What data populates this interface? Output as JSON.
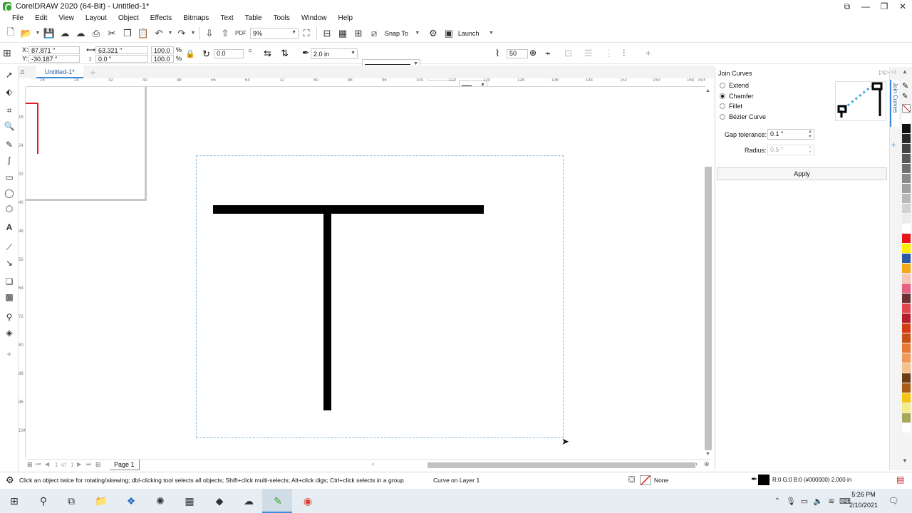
{
  "window": {
    "title": "CorelDRAW 2020 (64-Bit) - Untitled-1*"
  },
  "menu": [
    "File",
    "Edit",
    "View",
    "Layout",
    "Object",
    "Effects",
    "Bitmaps",
    "Text",
    "Table",
    "Tools",
    "Window",
    "Help"
  ],
  "toolbar": {
    "zoom": "9%",
    "snap_to": "Snap To",
    "launch": "Launch"
  },
  "propbar": {
    "x": "87.871 \"",
    "y": "-30.187 \"",
    "w": "63.321 \"",
    "h": "0.0 \"",
    "scale_x": "100.0",
    "scale_y": "100.0",
    "pct1": "%",
    "pct2": "%",
    "rotation": "0.0",
    "outline_width": "2.0 in",
    "steps": "50"
  },
  "doc": {
    "tab": "Untitled-1*"
  },
  "ruler": {
    "h_ticks": [
      "16",
      "24",
      "32",
      "40",
      "48",
      "56",
      "64",
      "72",
      "80",
      "88",
      "96",
      "104",
      "112",
      "120",
      "128",
      "136",
      "144",
      "152",
      "160",
      "168",
      "inches"
    ],
    "v_ticks": [
      "16",
      "24",
      "32",
      "40",
      "48",
      "56",
      "64",
      "72",
      "80",
      "88",
      "96",
      "104"
    ]
  },
  "pages": {
    "current": "1",
    "of_label": "of",
    "total": "1",
    "page_tab": "Page 1"
  },
  "docker": {
    "title": "Join Curves",
    "side_tab": "Join Curves",
    "options": [
      {
        "label": "Extend",
        "selected": false
      },
      {
        "label": "Chamfer",
        "selected": true
      },
      {
        "label": "Fillet",
        "selected": false
      },
      {
        "label": "Bézier Curve",
        "selected": false
      }
    ],
    "gap_label": "Gap tolerance:",
    "gap_value": "0.1 \"",
    "radius_label": "Radius:",
    "radius_value": "0.5 \"",
    "apply": "Apply"
  },
  "status": {
    "hint": "Click an object twice for rotating/skewing; dbl-clicking tool selects all objects; Shift+click multi-selects; Alt+click digs; Ctrl+click selects in a group",
    "object": "Curve on Layer 1",
    "fill": "None",
    "outline": "R:0 G:0 B:0 (#000000)  2.000 in"
  },
  "taskbar": {
    "time": "5:26 PM",
    "date": "2/10/2021"
  },
  "palette": [
    "#ffffff",
    "#111111",
    "#2a2a2a",
    "#444444",
    "#5a5a5a",
    "#707070",
    "#8a8a8a",
    "#a0a0a0",
    "#b8b8b8",
    "#d2d2d2",
    "#ebebeb",
    "#ffffff",
    "#e8141c",
    "#ffec00",
    "#2d5aa8",
    "#f6a81b",
    "#f4c6b8",
    "#e86080",
    "#6c3232",
    "#e04850",
    "#b41e2a",
    "#d43c14",
    "#c85014",
    "#e87838",
    "#f09858",
    "#f4c090",
    "#6c3c14",
    "#a85c14",
    "#f4c414",
    "#f4ec8c",
    "#a8a85c",
    "#ffffff"
  ]
}
